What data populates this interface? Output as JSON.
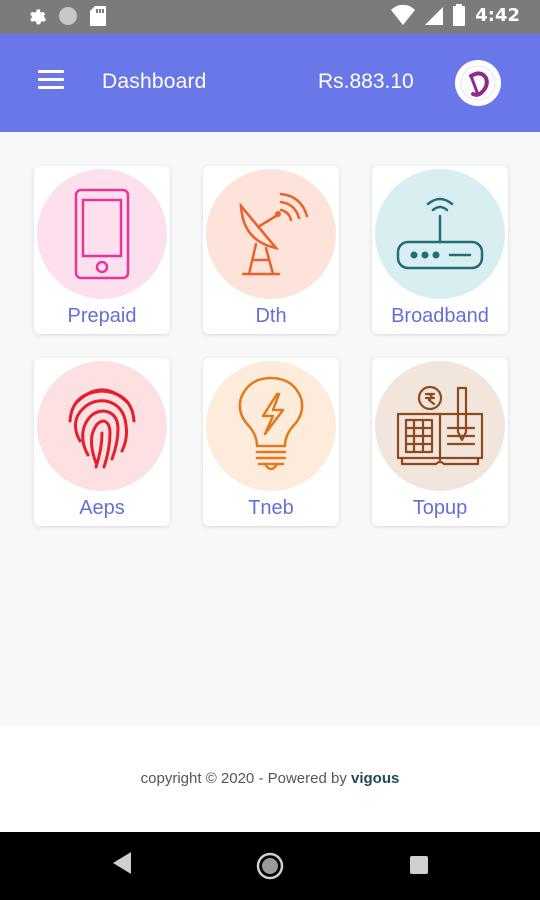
{
  "status_bar": {
    "time": "4:42",
    "icons": [
      "settings-icon",
      "circle-icon",
      "sd-card-icon",
      "wifi-icon",
      "signal-icon",
      "battery-icon"
    ]
  },
  "app_bar": {
    "title": "Dashboard",
    "balance": "Rs.883.10",
    "menu_icon": "hamburger-menu-icon",
    "avatar_icon": "brand-logo-icon",
    "color": "#6a77e8"
  },
  "tiles": [
    {
      "label": "Prepaid",
      "icon": "mobile-phone-icon",
      "bg": "#fde0ee"
    },
    {
      "label": "Dth",
      "icon": "satellite-dish-icon",
      "bg": "#fde3da"
    },
    {
      "label": "Broadband",
      "icon": "router-icon",
      "bg": "#d9eef0"
    },
    {
      "label": "Aeps",
      "icon": "fingerprint-icon",
      "bg": "#fde0e2"
    },
    {
      "label": "Tneb",
      "icon": "light-bulb-icon",
      "bg": "#fdebdb"
    },
    {
      "label": "Topup",
      "icon": "accounting-book-icon",
      "bg": "#f1e5dc"
    }
  ],
  "footer": {
    "copyright": "copyright © 2020 - Powered by ",
    "brand": "vigous"
  },
  "nav_bar": {
    "icons": [
      "back-icon",
      "home-icon",
      "recents-icon"
    ]
  }
}
